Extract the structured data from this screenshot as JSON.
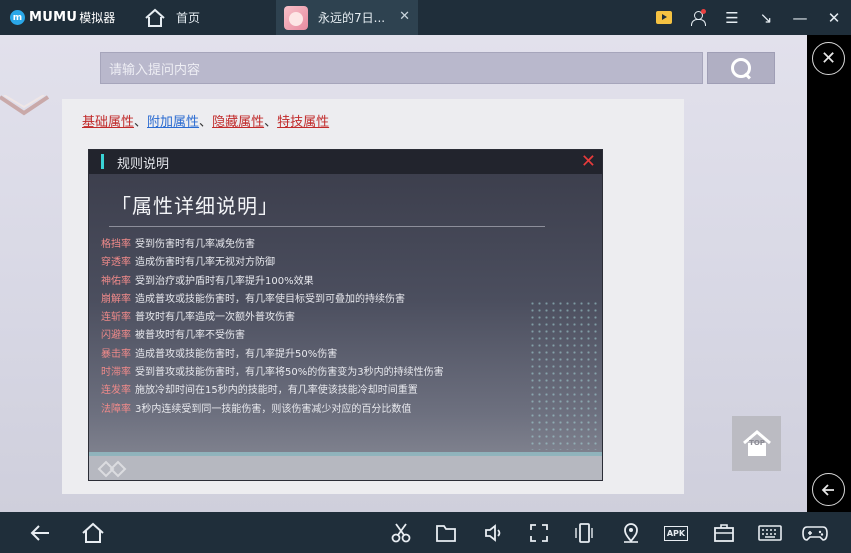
{
  "topbar": {
    "logo_text": "MUMU",
    "logo_sub": "模拟器",
    "tabs": [
      {
        "label": "首页"
      },
      {
        "label": "永远的7日..."
      }
    ],
    "tab_close": "✕",
    "controls": {
      "minimize": "—",
      "close": "✕",
      "expand": "↘",
      "menu": "☰"
    }
  },
  "search": {
    "placeholder": "请输入提问内容"
  },
  "content": {
    "links": [
      "基础属性",
      "附加属性",
      "隐藏属性",
      "特技属性"
    ],
    "link_separator": "、"
  },
  "panel": {
    "header_title": "规则说明",
    "close_glyph": "✕",
    "big_title": "「属性详细说明」",
    "attributes": [
      {
        "name": "格挡率",
        "desc": "受到伤害时有几率减免伤害"
      },
      {
        "name": "穿透率",
        "desc": "造成伤害时有几率无视对方防御"
      },
      {
        "name": "神佑率",
        "desc": "受到治疗或护盾时有几率提升100%效果"
      },
      {
        "name": "崩解率",
        "desc": "造成普攻或技能伤害时，有几率使目标受到可叠加的持续伤害"
      },
      {
        "name": "连斩率",
        "desc": "普攻时有几率造成一次额外普攻伤害"
      },
      {
        "name": "闪避率",
        "desc": "被普攻时有几率不受伤害"
      },
      {
        "name": "暴击率",
        "desc": "造成普攻或技能伤害时，有几率提升50%伤害"
      },
      {
        "name": "时滞率",
        "desc": "受到普攻或技能伤害时，有几率将50%的伤害变为3秒内的持续性伤害"
      },
      {
        "name": "连发率",
        "desc": "施放冷却时间在15秒内的技能时，有几率使该技能冷却时间重置"
      },
      {
        "name": "法障率",
        "desc": "3秒内连续受到同一技能伤害，则该伤害减少对应的百分比数值"
      }
    ]
  },
  "top_button": {
    "label": "TOP"
  },
  "colors": {
    "accent": "#3ad3d6",
    "link_red": "#c12a2a",
    "link_blue": "#2a6bd1",
    "attr_name": "#f08a8a"
  }
}
